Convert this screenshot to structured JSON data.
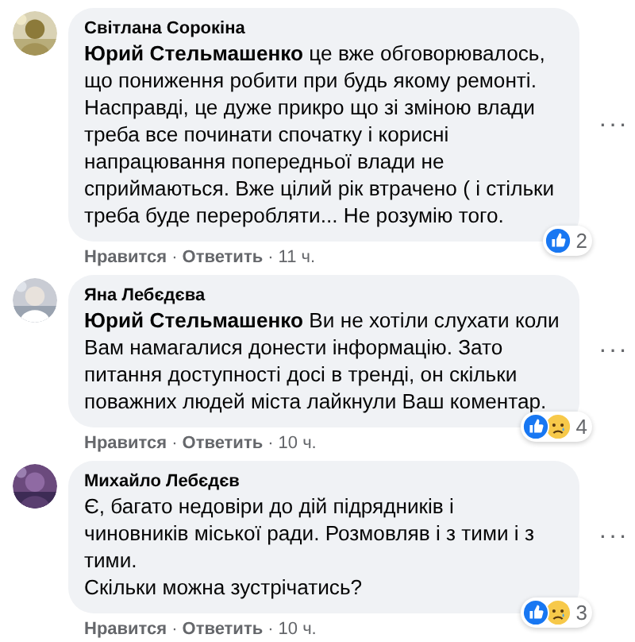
{
  "comments": [
    {
      "author": "Світлана Сорокіна",
      "avatar": {
        "kind": "picture"
      },
      "paragraphs": [
        "**Юрий Стельмашенко** це вже обговорювалось, що пониження робити при будь якому ремонті. Насправді, це дуже прикро що зі зміною влади треба все починати спочатку і корисні напрацювання попередньої влади не сприймаються. Вже цілий рік втрачено ( і стільки треба буде переробляти... Не розумію того."
      ],
      "reactions": [
        {
          "kind": "like"
        }
      ],
      "reaction_count": "2",
      "more": "···",
      "actions": [
        "Нравится",
        "Ответить",
        "11 ч."
      ],
      "separator": "·"
    },
    {
      "author": "Яна Лебєдєва",
      "avatar": {
        "kind": "picture"
      },
      "paragraphs": [
        "**Юрий Стельмашенко** Ви не хотіли слухати коли Вам намагалися донести інформацію. Зато питання доступності досі в тренді, он скільки поважних людей міста лайкнули Ваш коментар."
      ],
      "reactions": [
        {
          "kind": "like"
        },
        {
          "kind": "sad"
        }
      ],
      "reaction_count": "4",
      "more": "···",
      "actions": [
        "Нравится",
        "Ответить",
        "10 ч."
      ],
      "separator": "·"
    },
    {
      "author": "Михайло Лебєдєв",
      "avatar": {
        "kind": "picture"
      },
      "paragraphs": [
        "Є, багато недовіри до дій підрядників і чиновників міської ради. Розмовляв і з тими і з тими.",
        "Скільки можна зустрічатись?"
      ],
      "reactions": [
        {
          "kind": "like"
        },
        {
          "kind": "sad"
        }
      ],
      "reaction_count": "3",
      "more": "···",
      "actions": [
        "Нравится",
        "Ответить",
        "10 ч."
      ],
      "separator": "·"
    }
  ]
}
